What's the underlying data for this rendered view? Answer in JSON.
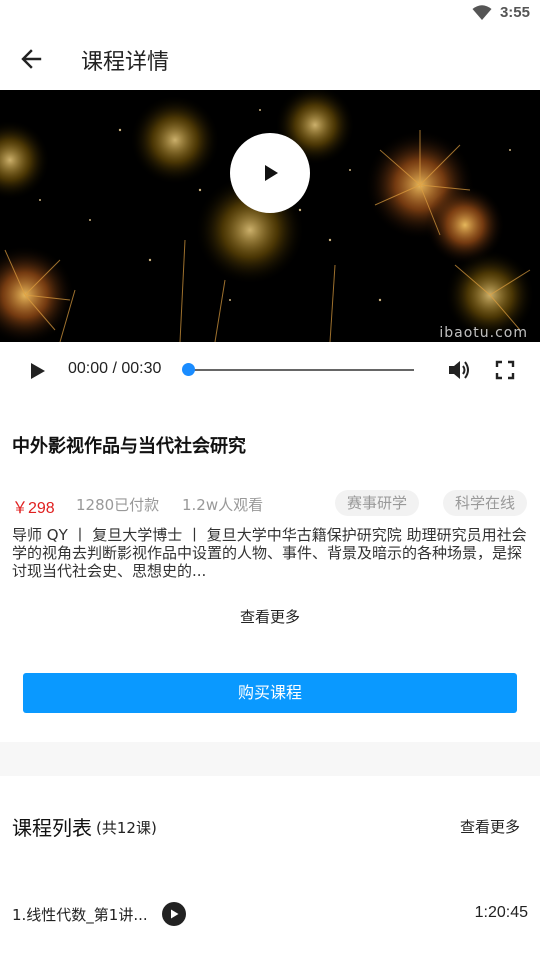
{
  "status_bar": {
    "time": "3:55",
    "wifi_icon": "wifi-icon"
  },
  "app_bar": {
    "back_icon": "arrow-left-icon",
    "title": "课程详情"
  },
  "video": {
    "watermark": "ibaotu.com",
    "play_icon": "play-icon"
  },
  "player": {
    "time": "00:00 / 00:30",
    "progress": 0,
    "play_icon": "play-icon",
    "volume_icon": "volume-icon",
    "fullscreen_icon": "fullscreen-icon",
    "accent": "#1a8cff"
  },
  "course": {
    "title": "中外影视作品与当代社会研究",
    "price": "￥298",
    "paid": "1280已付款",
    "views": "1.2w人观看",
    "tags": [
      "赛事研学",
      "科学在线"
    ],
    "description": "导师 QY  丨  复旦大学博士  丨  复旦大学中华古籍保护研究院 助理研究员用社会学的视角去判断影视作品中设置的人物、事件、背景及暗示的各种场景，是探讨现当代社会史、思想史的...",
    "more": "查看更多",
    "buy": "购买课程",
    "buy_color": "#0a99ff",
    "price_color": "#e02020"
  },
  "lesson_list": {
    "title": "课程列表",
    "count": "(共12课)",
    "more": "查看更多",
    "items": [
      {
        "title": "1.线性代数_第1讲...",
        "duration": "1:20:45"
      }
    ]
  }
}
